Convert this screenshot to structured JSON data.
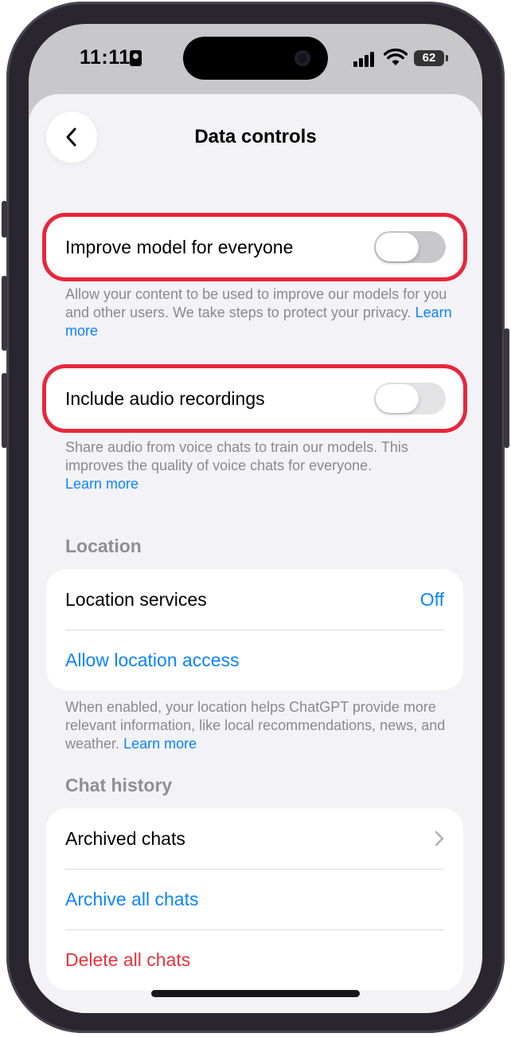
{
  "status_bar": {
    "time": "11:11",
    "battery": "62"
  },
  "header": {
    "title": "Data controls"
  },
  "improve_model": {
    "label": "Improve model for everyone",
    "enabled": false,
    "footnote": "Allow your content to be used to improve our models for you and other users. We take steps to protect your privacy.",
    "link": "Learn more"
  },
  "audio_recordings": {
    "label": "Include audio recordings",
    "enabled": false,
    "footnote": "Share audio from voice chats to train our models. This improves the quality of voice chats for everyone.",
    "link": "Learn more"
  },
  "location": {
    "section_title": "Location",
    "services_label": "Location services",
    "services_value": "Off",
    "allow_access_label": "Allow location access",
    "footnote": "When enabled, your location helps ChatGPT provide more relevant information, like local recommendations, news, and weather.",
    "link": "Learn more"
  },
  "chat_history": {
    "section_title": "Chat history",
    "archived_label": "Archived chats",
    "archive_all_label": "Archive all chats",
    "delete_all_label": "Delete all chats"
  },
  "colors": {
    "accent_blue": "#0a84ff",
    "destructive_red": "#e8323e",
    "highlight_red": "#e8263c",
    "switch_off": "#e3e3e5"
  },
  "icons": {
    "back": "chevron-left-icon",
    "row_disclosure": "chevron-right-icon"
  }
}
